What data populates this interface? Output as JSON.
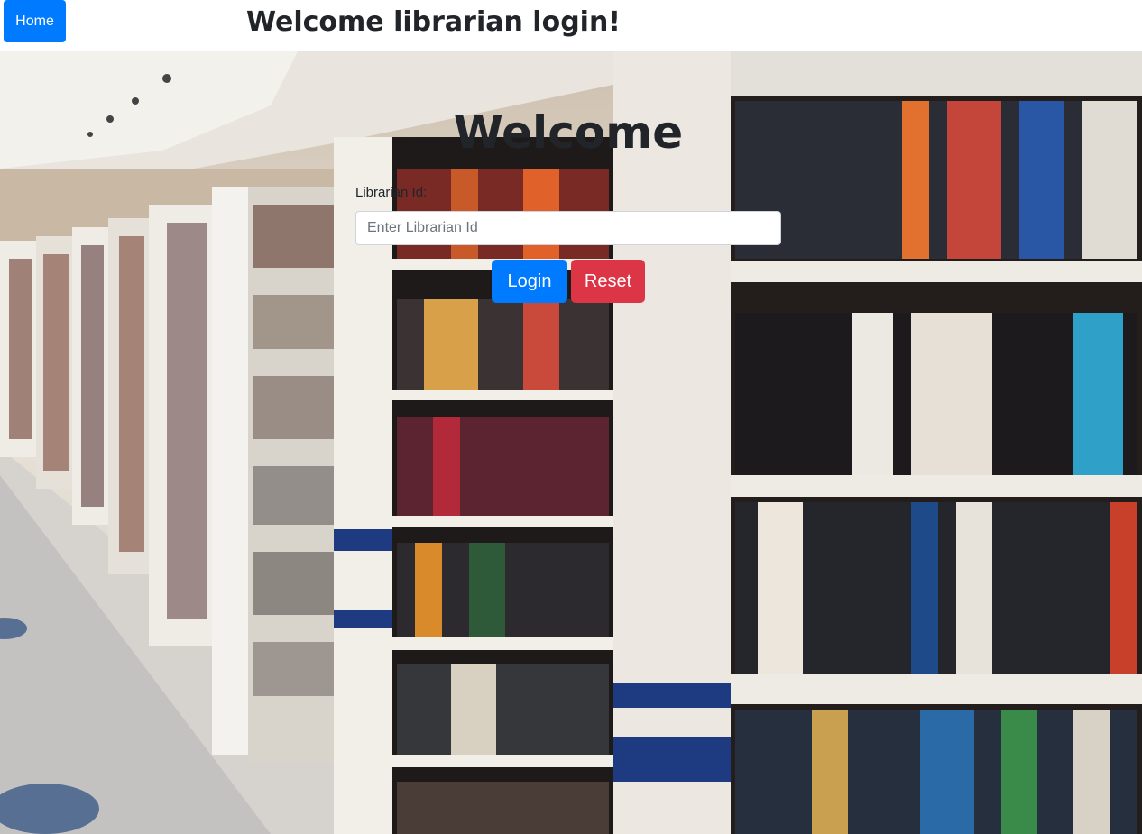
{
  "nav": {
    "home_label": "Home"
  },
  "header": {
    "title": "Welcome librarian login!"
  },
  "form": {
    "heading": "Welcome",
    "id_label": "Librarian Id:",
    "id_placeholder": "Enter Librarian Id",
    "id_value": "",
    "login_label": "Login",
    "reset_label": "Reset"
  },
  "background": {
    "subject": "library-bookshelves-photo"
  },
  "colors": {
    "primary": "#007bff",
    "danger": "#dc3545",
    "heading_text": "#212529"
  }
}
